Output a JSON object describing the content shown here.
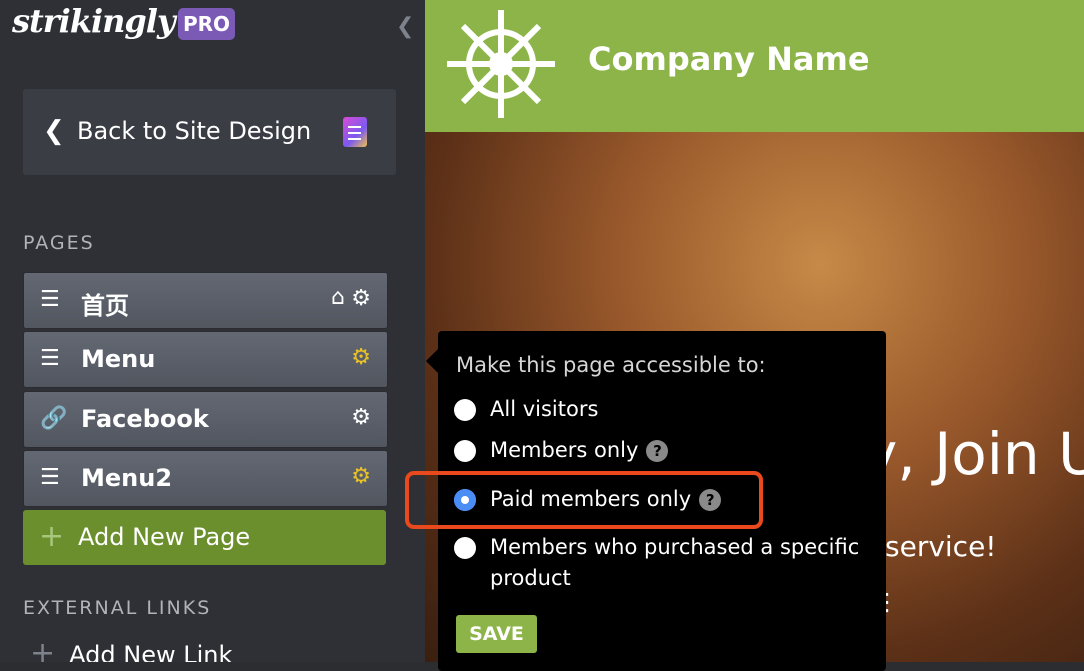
{
  "sidebar": {
    "logo": "strikingly",
    "pro_badge": "PRO",
    "back_button": "Back to Site Design",
    "pages_label": "PAGES",
    "pages": [
      {
        "name": "首页",
        "icon": "menu-lines-icon",
        "has_home": true,
        "settings_color": "#ffffff"
      },
      {
        "name": "Menu",
        "icon": "menu-lines-icon",
        "has_home": false,
        "settings_color": "#e8c227"
      },
      {
        "name": "Facebook",
        "icon": "link-icon",
        "has_home": false,
        "settings_color": "#ffffff"
      },
      {
        "name": "Menu2",
        "icon": "menu-lines-icon",
        "has_home": false,
        "settings_color": "#e8c227"
      }
    ],
    "add_page": "Add New Page",
    "external_links_label": "EXTERNAL LINKS",
    "add_link": "Add New Link"
  },
  "preview": {
    "company_name": "Company Name",
    "hero_title_partial": "y, Join U",
    "hero_subtitle_partial": "service!",
    "header_color": "#8cb448"
  },
  "popover": {
    "title": "Make this page accessible to:",
    "options": [
      {
        "label": "All visitors",
        "selected": false,
        "help": false
      },
      {
        "label": "Members only",
        "selected": false,
        "help": true
      },
      {
        "label": "Paid members only",
        "selected": true,
        "help": true
      },
      {
        "label": "Members who purchased a specific",
        "label_line2": "product",
        "selected": false,
        "help": false
      }
    ],
    "help_glyph": "?",
    "save": "SAVE"
  },
  "colors": {
    "accent_green": "#8cb448",
    "highlight": "#e8491d",
    "pro": "#7b5ab6"
  }
}
